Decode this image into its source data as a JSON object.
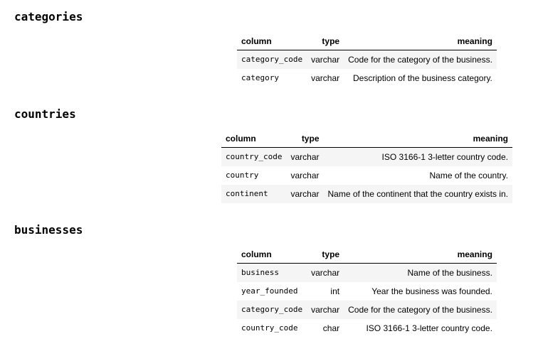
{
  "headers": {
    "column": "column",
    "type": "type",
    "meaning": "meaning"
  },
  "sections": [
    {
      "name": "categories",
      "rows": [
        {
          "column": "category_code",
          "type": "varchar",
          "meaning": "Code for the category of the business."
        },
        {
          "column": "category",
          "type": "varchar",
          "meaning": "Description of the business category."
        }
      ]
    },
    {
      "name": "countries",
      "rows": [
        {
          "column": "country_code",
          "type": "varchar",
          "meaning": "ISO 3166-1 3-letter country code."
        },
        {
          "column": "country",
          "type": "varchar",
          "meaning": "Name of the country."
        },
        {
          "column": "continent",
          "type": "varchar",
          "meaning": "Name of the continent that the country exists in."
        }
      ]
    },
    {
      "name": "businesses",
      "rows": [
        {
          "column": "business",
          "type": "varchar",
          "meaning": "Name of the business."
        },
        {
          "column": "year_founded",
          "type": "int",
          "meaning": "Year the business was founded."
        },
        {
          "column": "category_code",
          "type": "varchar",
          "meaning": "Code for the category of the business."
        },
        {
          "column": "country_code",
          "type": "char",
          "meaning": "ISO 3166-1 3-letter country code."
        }
      ]
    }
  ]
}
